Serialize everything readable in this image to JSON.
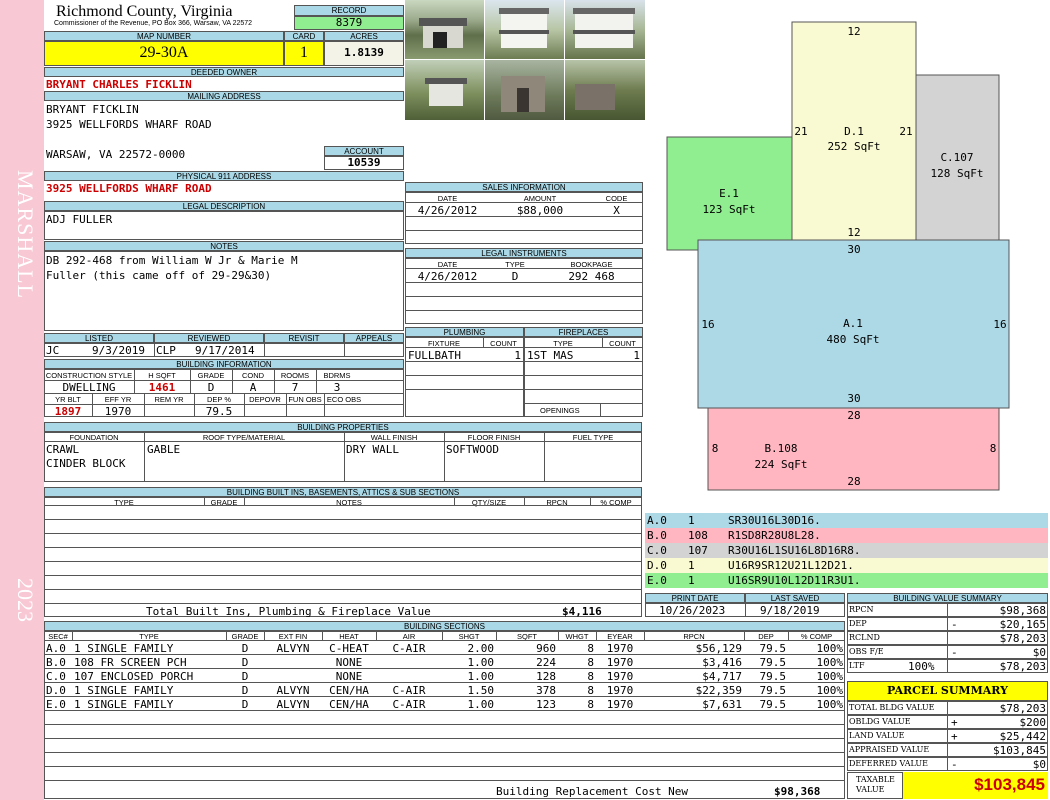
{
  "side": {
    "district": "MARSHALL",
    "year": "2023"
  },
  "header": {
    "county": "Richmond County, Virginia",
    "commissioner": "Commissioner of the Revenue, PO Box 366, Warsaw, VA 22572",
    "record_label": "RECORD",
    "record": "8379",
    "map_label": "MAP NUMBER",
    "map": "29-30A",
    "card_label": "CARD",
    "card": "1",
    "acres_label": "ACRES",
    "acres": "1.8139"
  },
  "owner": {
    "label": "DEEDED OWNER",
    "name": "BRYANT CHARLES FICKLIN",
    "mailing_label": "MAILING ADDRESS",
    "mail1": "BRYANT FICKLIN",
    "mail2": "3925 WELLFORDS WHARF ROAD",
    "mail3": "WARSAW, VA 22572-0000",
    "account_label": "ACCOUNT",
    "account": "10539",
    "phys_label": "PHYSICAL 911 ADDRESS",
    "phys": "3925 WELLFORDS WHARF ROAD"
  },
  "legal": {
    "label": "LEGAL DESCRIPTION",
    "text": "ADJ FULLER"
  },
  "notes": {
    "label": "NOTES",
    "line1": "DB 292-468 from William W Jr & Marie M",
    "line2": "Fuller (this came off of 29-29&30)"
  },
  "review": {
    "listed_label": "LISTED",
    "listed_by": "JC",
    "listed_date": "9/3/2019",
    "reviewed_label": "REVIEWED",
    "reviewed_by": "CLP",
    "reviewed_date": "9/17/2014",
    "revisit_label": "REVISIT",
    "appeals_label": "APPEALS"
  },
  "building_info": {
    "label": "BUILDING INFORMATION",
    "cols": [
      "CONSTRUCTION STYLE",
      "H SQFT",
      "GRADE",
      "COND",
      "ROOMS",
      "BDRMS"
    ],
    "vals": [
      "DWELLING",
      "1461",
      "D",
      "A",
      "7",
      "3"
    ],
    "cols2": [
      "YR BLT",
      "EFF YR",
      "REM YR",
      "DEP %",
      "DEPOVR",
      "FUN OBS",
      "ECO OBS"
    ],
    "vals2": [
      "1897",
      "1970",
      "",
      "79.5",
      "",
      "",
      ""
    ]
  },
  "sales": {
    "label": "SALES INFORMATION",
    "cols": [
      "DATE",
      "AMOUNT",
      "CODE"
    ],
    "row": [
      "4/26/2012",
      "$88,000",
      "X"
    ]
  },
  "legal_inst": {
    "label": "LEGAL INSTRUMENTS",
    "cols": [
      "DATE",
      "TYPE",
      "BOOKPAGE"
    ],
    "row": [
      "4/26/2012",
      "D",
      "292 468"
    ]
  },
  "plumbing": {
    "label": "PLUMBING",
    "cols": [
      "FIXTURE",
      "COUNT"
    ],
    "row": [
      "FULLBATH",
      "1"
    ]
  },
  "fireplaces": {
    "label": "FIREPLACES",
    "cols": [
      "TYPE",
      "COUNT"
    ],
    "row": [
      "1ST MAS",
      "1"
    ],
    "openings": "OPENINGS"
  },
  "properties": {
    "label": "BUILDING PROPERTIES",
    "cols": [
      "FOUNDATION",
      "ROOF TYPE/MATERIAL",
      "WALL FINISH",
      "FLOOR FINISH",
      "FUEL TYPE"
    ],
    "foundation1": "CRAWL",
    "foundation2": "CINDER BLOCK",
    "roof": "GABLE",
    "wall": "DRY WALL",
    "floor": "SOFTWOOD",
    "fuel": ""
  },
  "builtins": {
    "label": "BUILDING BUILT INS, BASEMENTS, ATTICS & SUB SECTIONS",
    "cols": [
      "TYPE",
      "GRADE",
      "NOTES",
      "QTY/SIZE",
      "RPCN",
      "% COMP"
    ],
    "total_label": "Total Built Ins, Plumbing & Fireplace Value",
    "total": "$4,116"
  },
  "sketch": {
    "sections": [
      {
        "id": "D.1",
        "sqft": "252 SqFt",
        "color": "#fafad2"
      },
      {
        "id": "C.107",
        "sqft": "128 SqFt",
        "color": "#d3d3d3"
      },
      {
        "id": "E.1",
        "sqft": "123 SqFt",
        "color": "#90ee90"
      },
      {
        "id": "A.1",
        "sqft": "480 SqFt",
        "color": "#add8e6"
      },
      {
        "id": "B.108",
        "sqft": "224 SqFt",
        "color": "#ffb6c1"
      }
    ],
    "dims": {
      "d_top": "12",
      "d_left": "21",
      "d_right": "21",
      "d_bottom": "12",
      "a_top": "30",
      "a_left": "16",
      "a_right": "16",
      "a_bottom": "30",
      "b_top": "28",
      "b_left": "8",
      "b_right": "8",
      "b_bottom": "28"
    },
    "legend": [
      {
        "sec": "A.0",
        "code": "1",
        "path": "SR30U16L30D16.",
        "color": "#add8e6"
      },
      {
        "sec": "B.0",
        "code": "108",
        "path": "R1SD8R28U8L28.",
        "color": "#ffb6c1"
      },
      {
        "sec": "C.0",
        "code": "107",
        "path": "R30U16L1SU16L8D16R8.",
        "color": "#d3d3d3"
      },
      {
        "sec": "D.0",
        "code": "1",
        "path": "U16R9SR12U21L12D21.",
        "color": "#fafad2"
      },
      {
        "sec": "E.0",
        "code": "1",
        "path": "U16SR9U10L12D11R3U1.",
        "color": "#90ee90"
      }
    ]
  },
  "print": {
    "print_label": "PRINT DATE",
    "print_date": "10/26/2023",
    "saved_label": "LAST SAVED",
    "saved_date": "9/18/2019"
  },
  "sections": {
    "label": "BUILDING SECTIONS",
    "cols": [
      "SEC#",
      "TYPE",
      "GRADE",
      "EXT FIN",
      "HEAT",
      "AIR",
      "SHGT",
      "SQFT",
      "WHGT",
      "EYEAR",
      "RPCN",
      "DEP",
      "% COMP"
    ],
    "rows": [
      [
        "A.0",
        "1 SINGLE FAMILY",
        "D",
        "ALVYN",
        "C-HEAT",
        "C-AIR",
        "2.00",
        "960",
        "8",
        "1970",
        "$56,129",
        "79.5",
        "100%"
      ],
      [
        "B.0",
        "108 FR SCREEN PCH",
        "D",
        "",
        "NONE",
        "",
        "1.00",
        "224",
        "8",
        "1970",
        "$3,416",
        "79.5",
        "100%"
      ],
      [
        "C.0",
        "107 ENCLOSED PORCH",
        "D",
        "",
        "NONE",
        "",
        "1.00",
        "128",
        "8",
        "1970",
        "$4,717",
        "79.5",
        "100%"
      ],
      [
        "D.0",
        "1 SINGLE FAMILY",
        "D",
        "ALVYN",
        "CEN/HA",
        "C-AIR",
        "1.50",
        "378",
        "8",
        "1970",
        "$22,359",
        "79.5",
        "100%"
      ],
      [
        "E.0",
        "1 SINGLE FAMILY",
        "D",
        "ALVYN",
        "CEN/HA",
        "C-AIR",
        "1.00",
        "123",
        "8",
        "1970",
        "$7,631",
        "79.5",
        "100%"
      ]
    ],
    "total_label": "Building Replacement Cost New",
    "total": "$98,368"
  },
  "value_summary": {
    "label": "BUILDING VALUE SUMMARY",
    "rows": [
      {
        "k": "RPCN",
        "op": "",
        "v": "$98,368"
      },
      {
        "k": "DEP",
        "op": "-",
        "v": "$20,165"
      },
      {
        "k": "RCLND",
        "op": "",
        "v": "$78,203"
      },
      {
        "k": "OBS F/E",
        "op": "-",
        "v": "$0"
      },
      {
        "k": "LTF",
        "op": "100%",
        "v": "$78,203"
      }
    ]
  },
  "parcel": {
    "label": "PARCEL SUMMARY",
    "rows": [
      {
        "k": "TOTAL BLDG VALUE",
        "op": "",
        "v": "$78,203"
      },
      {
        "k": "OBLDG VALUE",
        "op": "+",
        "v": "$200"
      },
      {
        "k": "LAND VALUE",
        "op": "+",
        "v": "$25,442"
      },
      {
        "k": "APPRAISED VALUE",
        "op": "",
        "v": "$103,845"
      },
      {
        "k": "DEFERRED VALUE",
        "op": "-",
        "v": "$0"
      }
    ],
    "taxable_label1": "TAXABLE",
    "taxable_label2": "VALUE",
    "taxable": "$103,845"
  }
}
